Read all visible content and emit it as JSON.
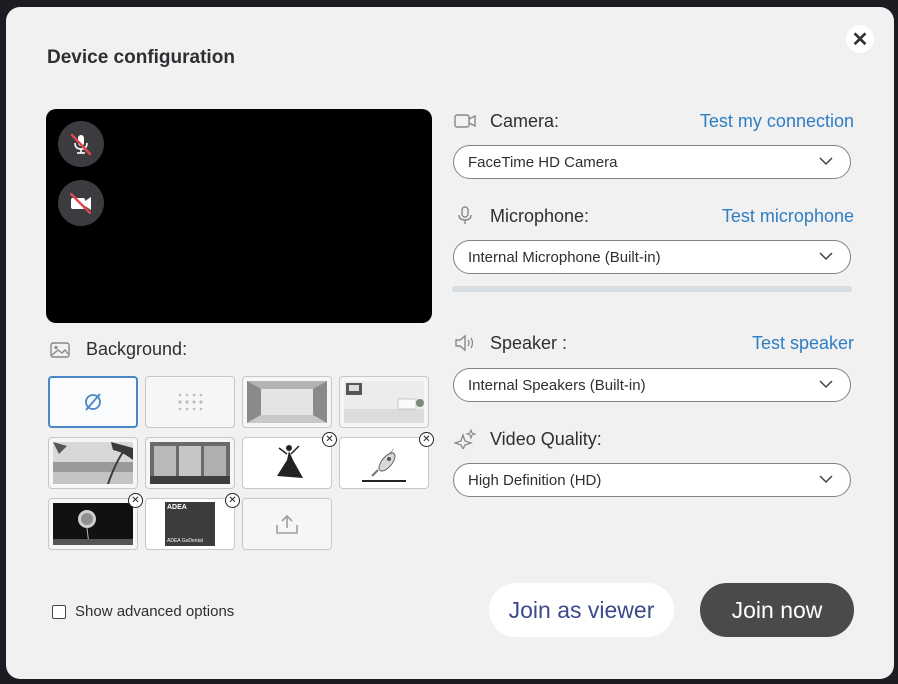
{
  "dialog": {
    "title": "Device configuration",
    "close_icon": "close-icon"
  },
  "preview": {
    "mic_state": "muted",
    "camera_state": "off"
  },
  "background": {
    "label": "Background:",
    "tiles": [
      {
        "name": "none",
        "selected": true
      },
      {
        "name": "blur",
        "selected": false
      },
      {
        "name": "empty-room",
        "selected": false
      },
      {
        "name": "white-office",
        "selected": false
      },
      {
        "name": "beach",
        "selected": false
      },
      {
        "name": "window-view",
        "selected": false
      },
      {
        "name": "dancer",
        "selected": false,
        "removable": true
      },
      {
        "name": "rocket",
        "selected": false,
        "removable": true
      },
      {
        "name": "dandelion",
        "selected": false,
        "removable": true
      },
      {
        "name": "adea-logo",
        "selected": false,
        "removable": true,
        "text_top": "ADEA",
        "text_bottom": "ADEA GoDental"
      },
      {
        "name": "upload",
        "selected": false
      }
    ]
  },
  "camera": {
    "label": "Camera:",
    "link": "Test my connection",
    "value": "FaceTime HD Camera"
  },
  "microphone": {
    "label": "Microphone:",
    "link": "Test microphone",
    "value": "Internal Microphone (Built-in)",
    "level": 0
  },
  "speaker": {
    "label": "Speaker :",
    "link": "Test speaker",
    "value": "Internal Speakers (Built-in)"
  },
  "video_quality": {
    "label": "Video Quality:",
    "value": "High Definition (HD)"
  },
  "advanced": {
    "label": "Show advanced options",
    "checked": false
  },
  "actions": {
    "viewer_label": "Join as viewer",
    "join_label": "Join now"
  },
  "colors": {
    "accent": "#2f7dc2",
    "join_button": "#4a4a4c",
    "viewer_text": "#3b4a8a",
    "muted_slash": "#e0484f"
  }
}
